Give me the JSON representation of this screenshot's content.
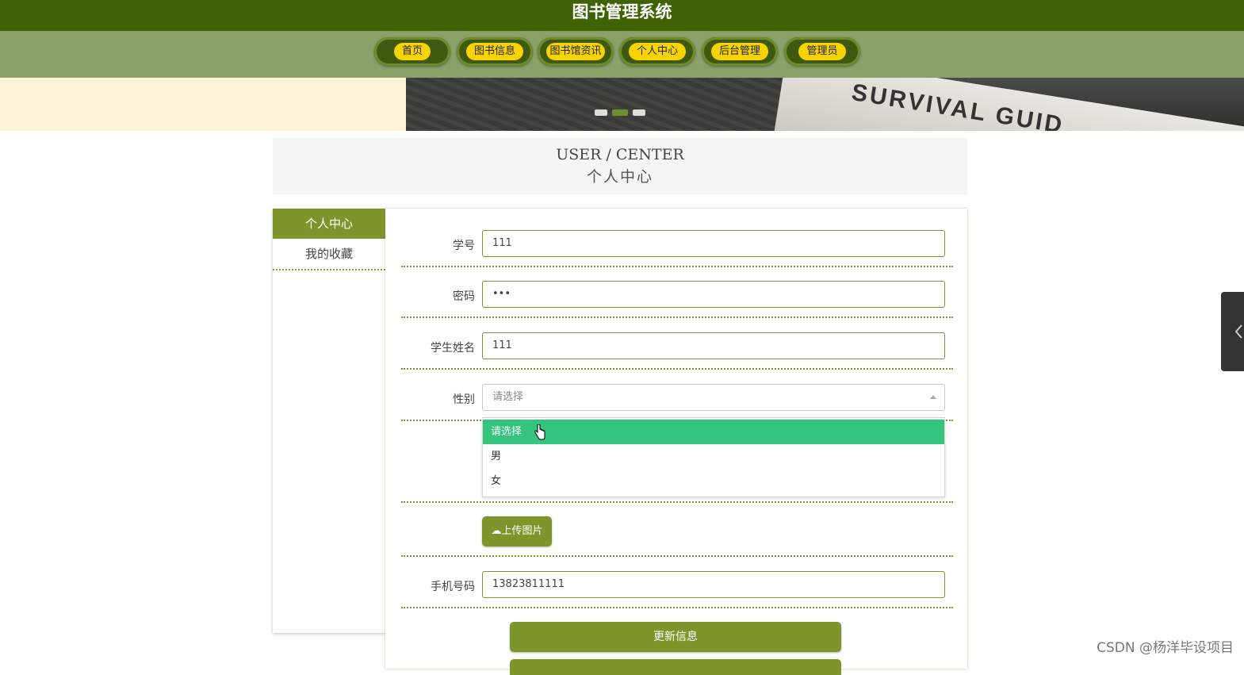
{
  "app_title": "图书管理系统",
  "nav": {
    "items": [
      {
        "label": "首页"
      },
      {
        "label": "图书信息"
      },
      {
        "label": "图书馆资讯"
      },
      {
        "label": "个人中心"
      },
      {
        "label": "后台管理"
      },
      {
        "label": "管理员"
      }
    ]
  },
  "banner": {
    "text": "SURVIVAL GUID",
    "slide_count": 3,
    "active_slide": 2
  },
  "page_header": {
    "title_en": "USER / CENTER",
    "title_cn": "个人中心"
  },
  "sidebar": {
    "items": [
      {
        "label": "个人中心",
        "active": true
      },
      {
        "label": "我的收藏",
        "active": false
      }
    ]
  },
  "form": {
    "student_id": {
      "label": "学号",
      "value": "111"
    },
    "password": {
      "label": "密码",
      "value": "•••"
    },
    "student_name": {
      "label": "学生姓名",
      "value": "111"
    },
    "gender": {
      "label": "性别",
      "placeholder": "请选择",
      "options": [
        "请选择",
        "男",
        "女"
      ],
      "highlighted": "请选择"
    },
    "upload_label": "上传图片",
    "phone": {
      "label": "手机号码",
      "value": "13823811111"
    },
    "update_button": "更新信息"
  },
  "colors": {
    "header": "#3f6304",
    "nav": "#8ca16a",
    "accent": "#7d952b",
    "nav_pill": "#f7d300",
    "dropdown_highlight": "#33c47e"
  },
  "watermark": "CSDN @杨洋毕设项目"
}
